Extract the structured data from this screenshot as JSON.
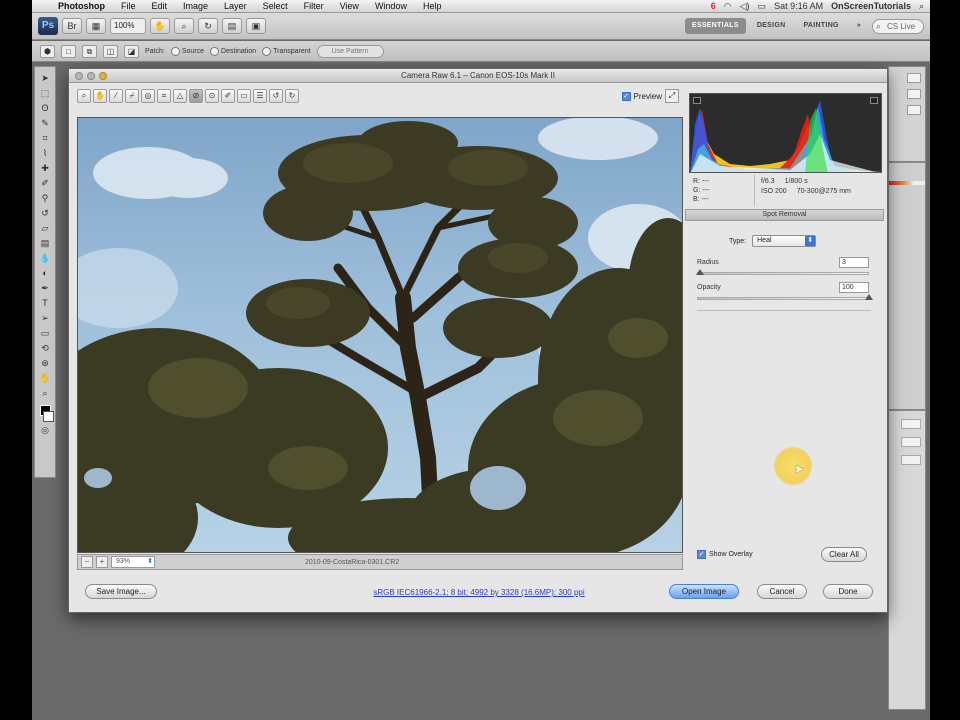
{
  "menubar": {
    "items": [
      "Photoshop",
      "File",
      "Edit",
      "Image",
      "Layer",
      "Select",
      "Filter",
      "View",
      "Window",
      "Help"
    ],
    "clock": "Sat 9:16 AM",
    "brand": "OnScreenTutorials"
  },
  "appbar": {
    "logo": "Ps",
    "zoom": "100%",
    "workspaces": [
      "ESSENTIALS",
      "DESIGN",
      "PAINTING"
    ],
    "search_placeholder": "CS Live"
  },
  "optionsbar": {
    "patch_label": "Patch:",
    "source_label": "Source",
    "destination_label": "Destination",
    "transparent_label": "Transparent",
    "use_pattern_label": "Use Pattern"
  },
  "dialog": {
    "title": "Camera Raw 6.1  –  Canon EOS-10s Mark II",
    "preview_label": "Preview",
    "zoom_value": "93%",
    "filename": "2010-09-CostaRica-0301.CR2",
    "info": {
      "r": "R:  ---",
      "g": "G:  ---",
      "b": "B:  ---",
      "aperture": "f/6.3",
      "shutter": "1/800 s",
      "iso": "ISO 200",
      "lens": "70-300@275 mm"
    },
    "panel_title": "Spot Removal",
    "type_label": "Type:",
    "type_value": "Heal",
    "radius_label": "Radius",
    "radius_value": "3",
    "radius_level": 0.02,
    "opacity_label": "Opacity",
    "opacity_value": "100",
    "opacity_level": 1.0,
    "show_overlay_label": "Show Overlay",
    "clear_all_label": "Clear All",
    "save_image_label": "Save Image...",
    "workflow_link": "sRGB IEC61966-2.1; 8 bit; 4992 by 3328 (16.6MP); 300 ppi",
    "open_image_label": "Open Image",
    "cancel_label": "Cancel",
    "done_label": "Done"
  },
  "colors": {
    "histogram_red": "#e21d1d",
    "histogram_blue": "#2a5cf0",
    "histogram_yellow": "#f3c21a",
    "histogram_cyan": "#3fe0ee",
    "highlight_cursor": "#f5cf52"
  },
  "icons": {
    "tools": [
      "zoom-icon",
      "hand-icon",
      "white-balance-icon",
      "color-sampler-icon",
      "targeted-adjustment-icon",
      "crop-icon",
      "straighten-icon",
      "spot-removal-icon",
      "red-eye-icon",
      "adjustment-brush-icon",
      "graduated-filter-icon",
      "preferences-icon",
      "rotate-ccw-icon",
      "rotate-cw-icon"
    ]
  }
}
